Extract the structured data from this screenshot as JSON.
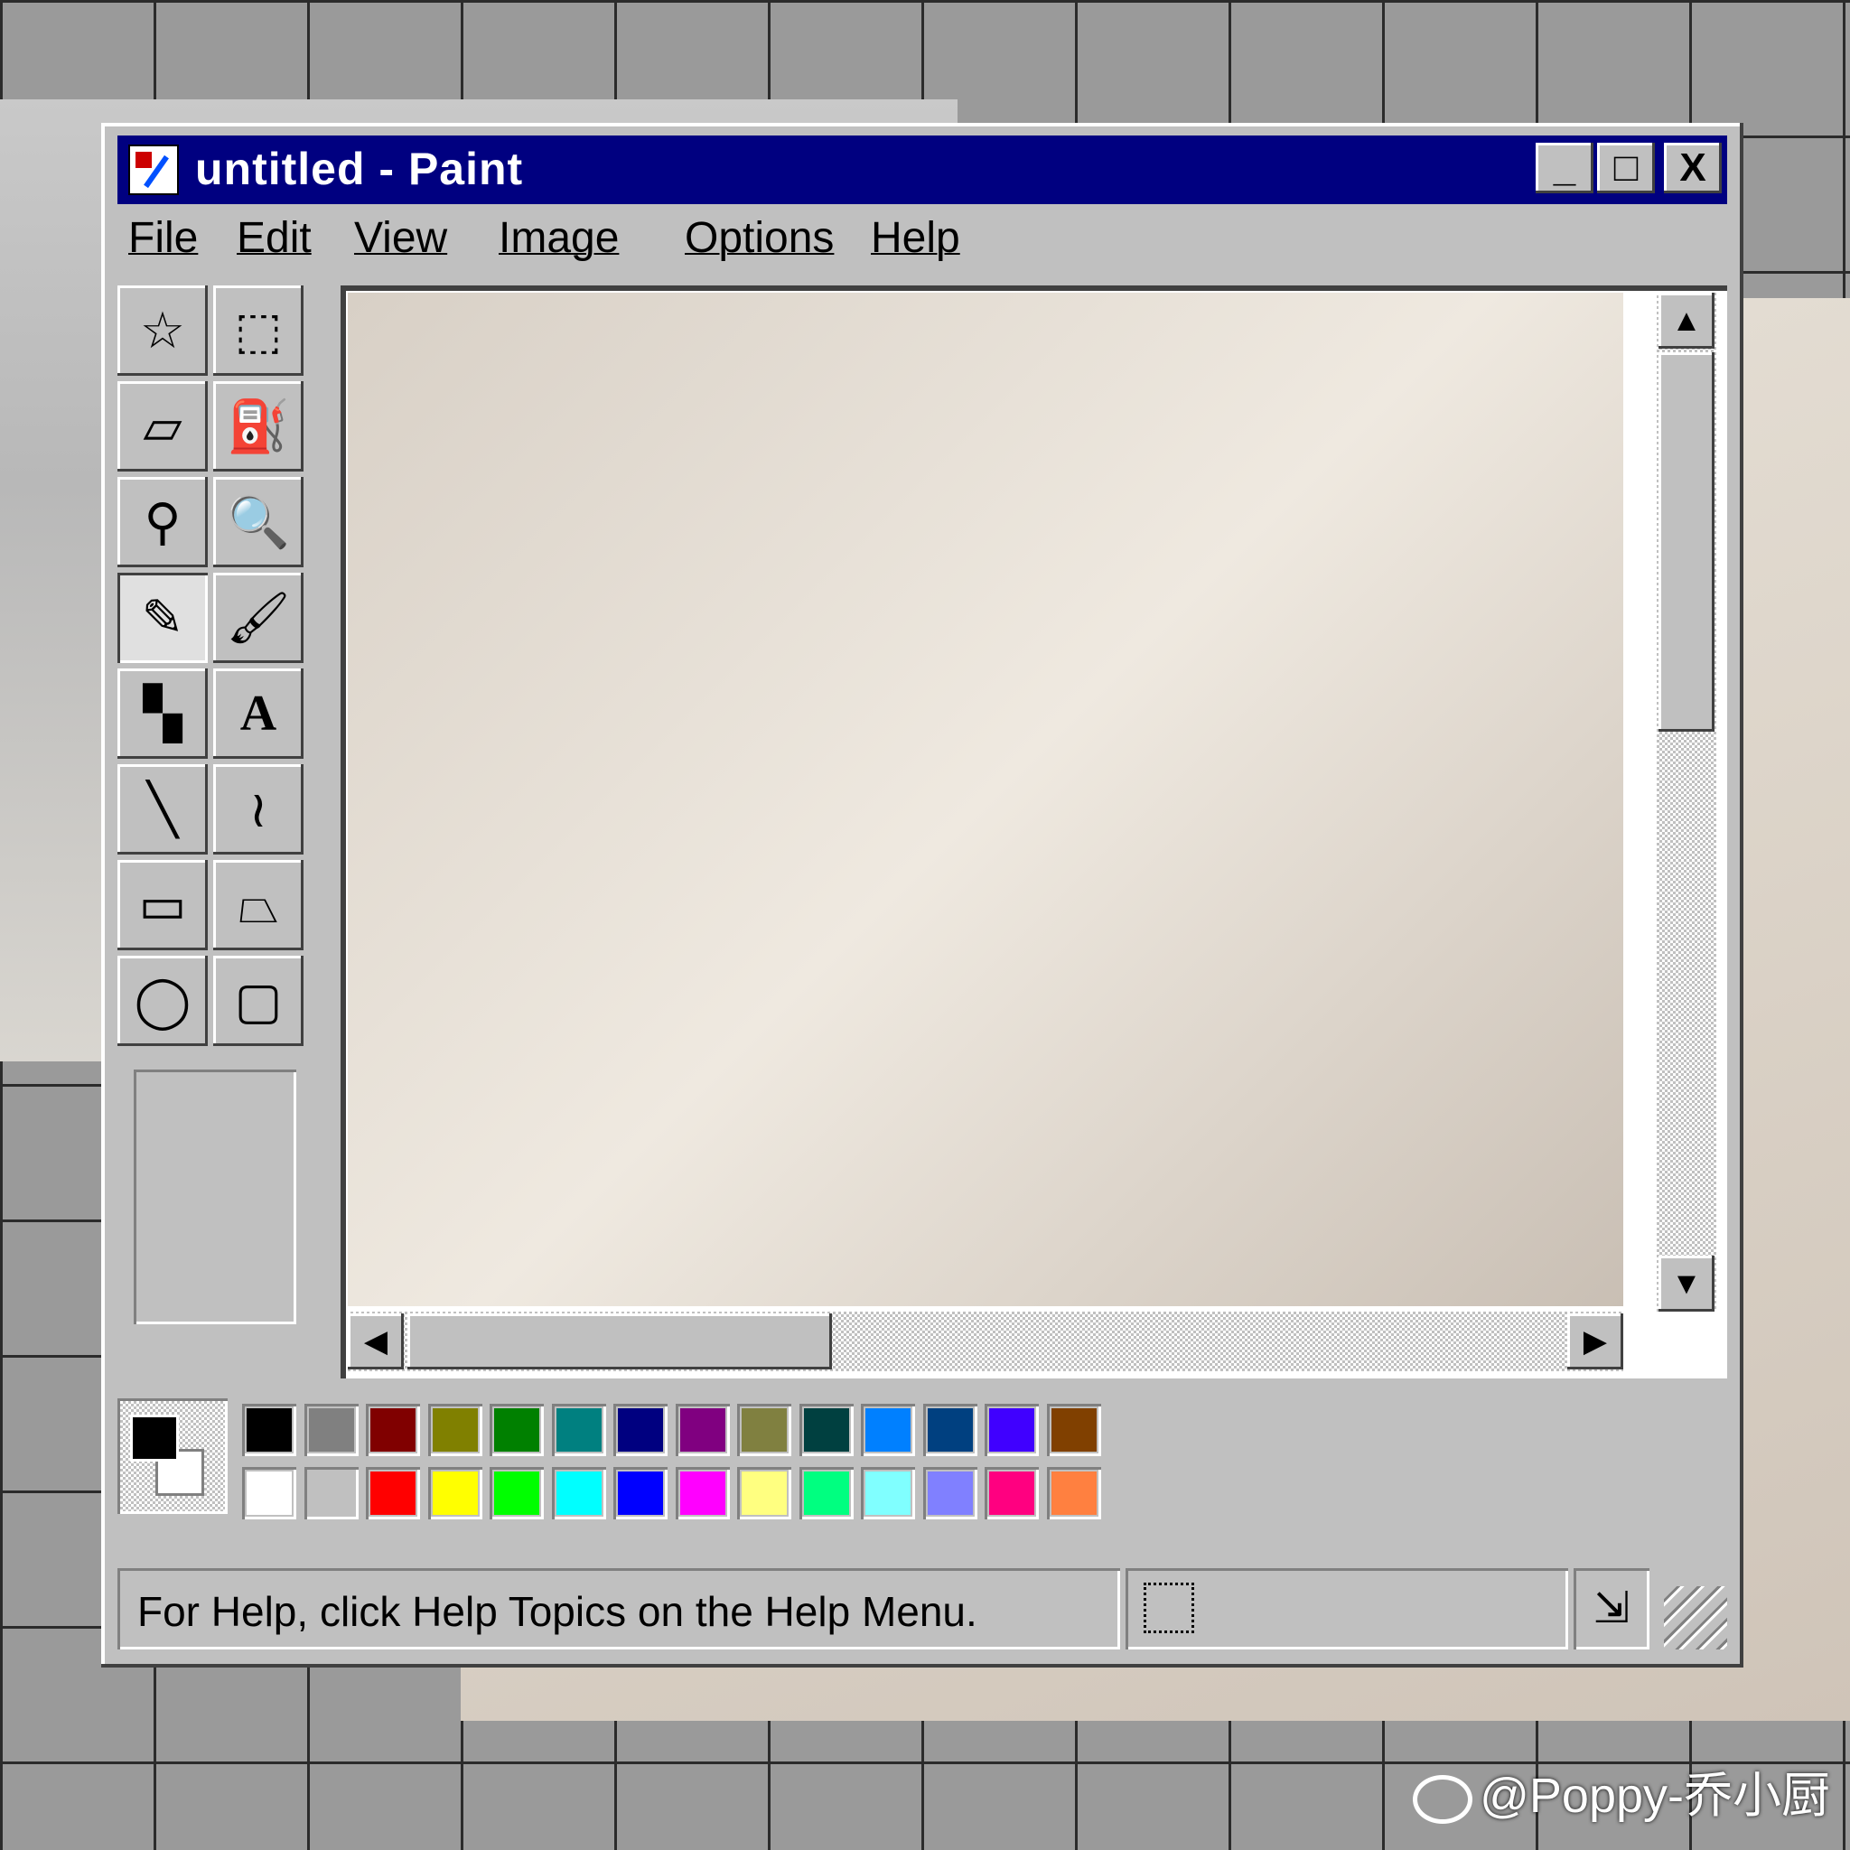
{
  "window": {
    "title": "untitled - Paint",
    "controls": {
      "minimize": "_",
      "maximize": "□",
      "close": "X"
    }
  },
  "menu": [
    {
      "label": "File"
    },
    {
      "label": "Edit"
    },
    {
      "label": "View"
    },
    {
      "label": "Image"
    },
    {
      "label": "Options"
    },
    {
      "label": "Help"
    }
  ],
  "tools": [
    {
      "name": "free-form-select",
      "glyph": "☆"
    },
    {
      "name": "rect-select",
      "glyph": "⬚"
    },
    {
      "name": "eraser",
      "glyph": "▱"
    },
    {
      "name": "fill-bucket",
      "glyph": "⛽"
    },
    {
      "name": "eyedropper",
      "glyph": "⚲"
    },
    {
      "name": "magnifier",
      "glyph": "🔍"
    },
    {
      "name": "pencil",
      "glyph": "✎",
      "active": true
    },
    {
      "name": "brush",
      "glyph": "🖌"
    },
    {
      "name": "airbrush",
      "glyph": "▚"
    },
    {
      "name": "text",
      "glyph": "A"
    },
    {
      "name": "line",
      "glyph": "╲"
    },
    {
      "name": "curve",
      "glyph": "≀"
    },
    {
      "name": "rectangle",
      "glyph": "▭"
    },
    {
      "name": "polygon",
      "glyph": "⏢"
    },
    {
      "name": "ellipse",
      "glyph": "◯"
    },
    {
      "name": "rounded-rect",
      "glyph": "▢"
    }
  ],
  "scroll": {
    "up": "▲",
    "down": "▼",
    "left": "◀",
    "right": "▶"
  },
  "palette": {
    "foreground": "#000000",
    "background": "#ffffff",
    "row1": [
      "#000000",
      "#808080",
      "#800000",
      "#808000",
      "#008000",
      "#008080",
      "#000080",
      "#800080",
      "#808040",
      "#004040",
      "#0080ff",
      "#004080",
      "#4000ff",
      "#804000"
    ],
    "row2": [
      "#ffffff",
      "#c0c0c0",
      "#ff0000",
      "#ffff00",
      "#00ff00",
      "#00ffff",
      "#0000ff",
      "#ff00ff",
      "#ffff80",
      "#00ff80",
      "#80ffff",
      "#8080ff",
      "#ff0080",
      "#ff8040"
    ]
  },
  "status": {
    "help_text": "For Help, click Help Topics on the Help Menu."
  },
  "watermark": "@Poppy-乔小厨"
}
